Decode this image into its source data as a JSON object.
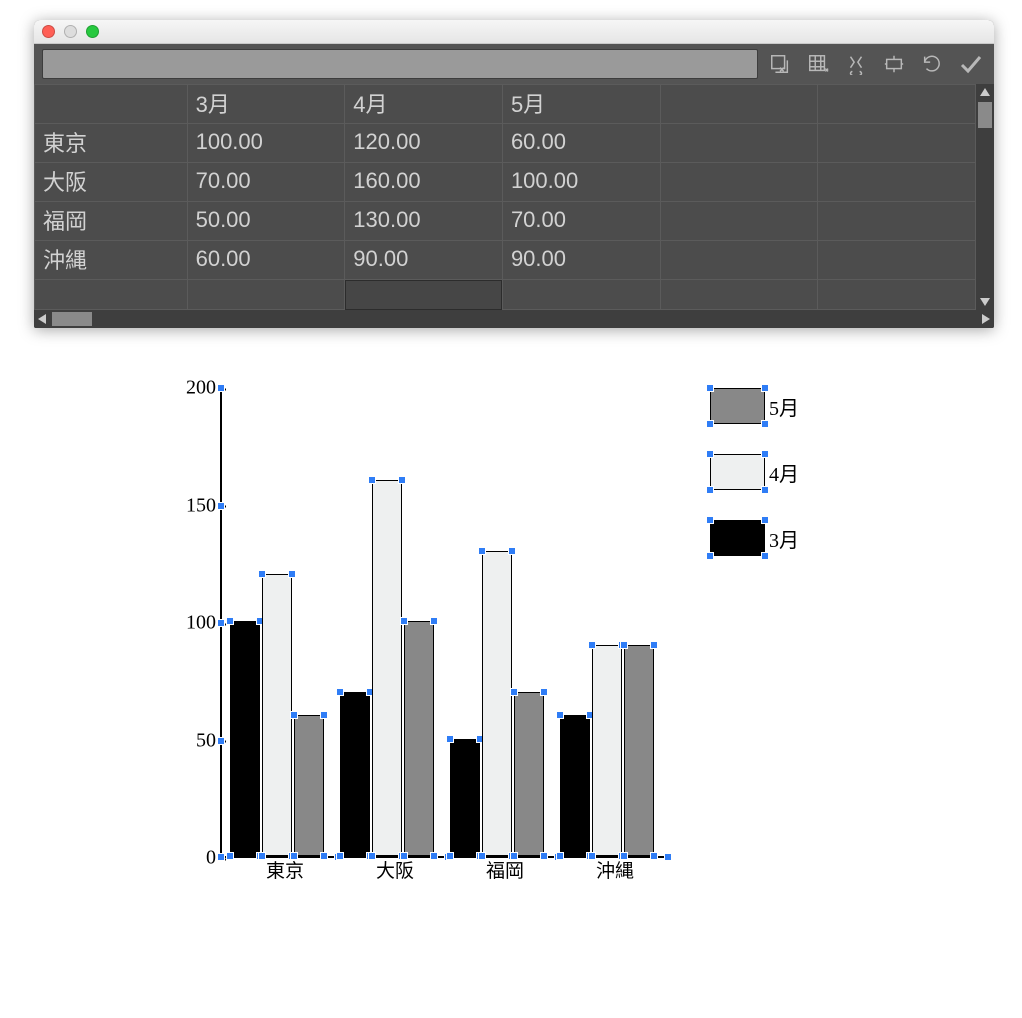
{
  "table": {
    "columns": [
      "3月",
      "4月",
      "5月"
    ],
    "rows": [
      {
        "label": "東京",
        "values": [
          "100.00",
          "120.00",
          "60.00"
        ]
      },
      {
        "label": "大阪",
        "values": [
          "70.00",
          "160.00",
          "100.00"
        ]
      },
      {
        "label": "福岡",
        "values": [
          "50.00",
          "130.00",
          "70.00"
        ]
      },
      {
        "label": "沖縄",
        "values": [
          "60.00",
          "90.00",
          "90.00"
        ]
      }
    ]
  },
  "chart_data": {
    "type": "bar",
    "categories": [
      "東京",
      "大阪",
      "福岡",
      "沖縄"
    ],
    "series": [
      {
        "name": "3月",
        "values": [
          100,
          70,
          50,
          60
        ],
        "color": "#000000"
      },
      {
        "name": "4月",
        "values": [
          120,
          160,
          130,
          90
        ],
        "color": "#eef0f0"
      },
      {
        "name": "5月",
        "values": [
          60,
          100,
          70,
          90
        ],
        "color": "#888888"
      }
    ],
    "legend_order": [
      "5月",
      "4月",
      "3月"
    ],
    "ylim": [
      0,
      200
    ],
    "yticks": [
      0,
      50,
      100,
      150,
      200
    ]
  }
}
